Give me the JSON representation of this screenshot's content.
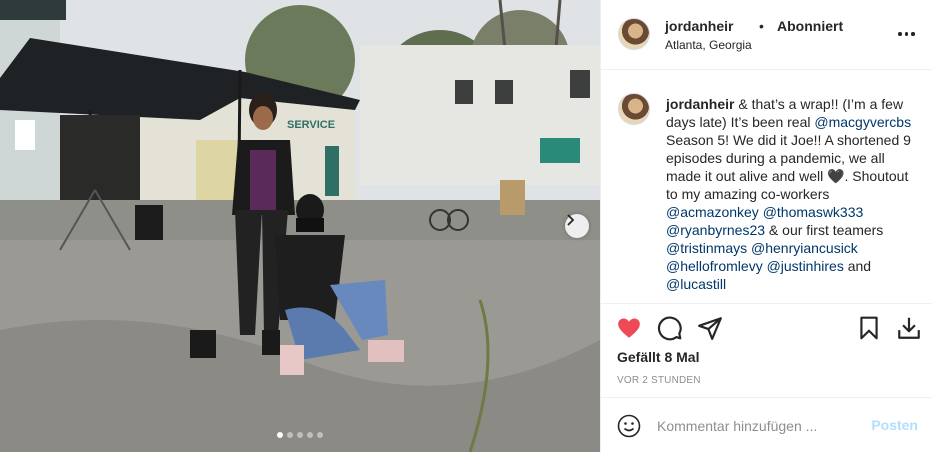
{
  "post": {
    "username": "jordanheir",
    "separator": "•",
    "follow_status": "Abonniert",
    "location": "Atlanta, Georgia"
  },
  "caption": {
    "username": "jordanheir",
    "parts": [
      " & that’s a wrap!! (I’m a few days late) It’s been real ",
      "@macgyvercbs",
      " Season 5! We did it Joe!! A shortened 9 episodes during a pandemic, we all made it out alive and well 🖤. Shoutout to my amazing co-workers ",
      "@acmazonkey",
      " ",
      "@thomaswk333",
      " ",
      "@ryanbyrnes23",
      " & our first teamers ",
      "@tristinmays",
      " ",
      "@henryiancusick",
      " ",
      "@hellofromlevy",
      " ",
      "@justinhires",
      " and ",
      "@lucastill"
    ]
  },
  "photo": {
    "sign_text": "SERVICE",
    "carousel": {
      "total": 5,
      "active": 0
    }
  },
  "engagement": {
    "likes": "Gefällt 8 Mal",
    "timestamp": "VOR 2 STUNDEN",
    "liked": true,
    "like_color": "#ed4956"
  },
  "comment_box": {
    "placeholder": "Kommentar hinzufügen ...",
    "post_label": "Posten"
  },
  "icons": {
    "like": "heart-icon",
    "comment": "comment-icon",
    "share": "share-icon",
    "save": "bookmark-icon",
    "download": "download-icon",
    "emoji": "emoji-icon",
    "more": "more-options-icon",
    "next": "chevron-right-icon"
  }
}
